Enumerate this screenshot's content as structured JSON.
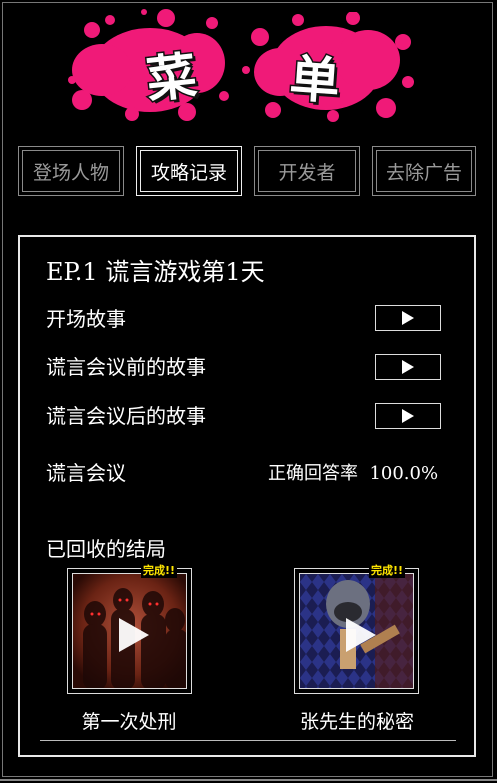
{
  "menu_title": {
    "char1": "菜",
    "char2": "单",
    "splat_color": "#f01a78"
  },
  "tabs": [
    {
      "label": "登场人物",
      "active": false
    },
    {
      "label": "攻略记录",
      "active": true
    },
    {
      "label": "开发者",
      "active": false
    },
    {
      "label": "去除广告",
      "active": false
    }
  ],
  "episode": {
    "title": "EP.1  谎言游戏第1天",
    "stories": [
      {
        "label": "开场故事"
      },
      {
        "label": "谎言会议前的故事"
      },
      {
        "label": "谎言会议后的故事"
      }
    ],
    "lie_meeting": {
      "label": "谎言会议",
      "stat_label": "正确回答率",
      "stat_value": "100.0%"
    },
    "endings_heading": "已回收的结局",
    "endings": [
      {
        "caption": "第一次处刑",
        "badge": "完成!!"
      },
      {
        "caption": "张先生的秘密",
        "badge": "完成!!"
      }
    ]
  }
}
